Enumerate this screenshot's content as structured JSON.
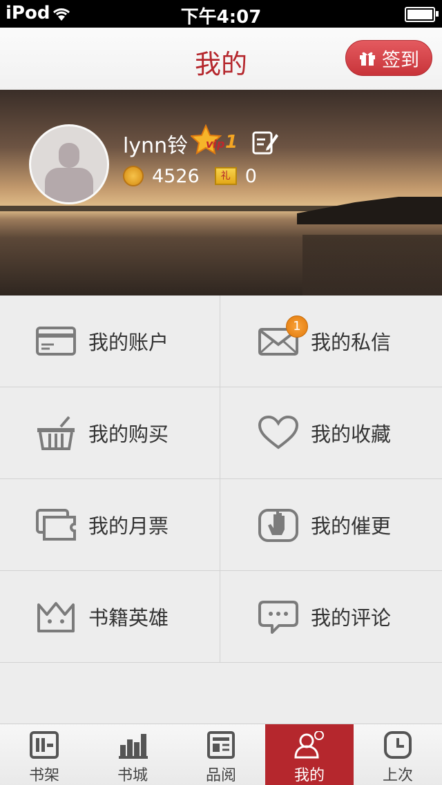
{
  "status_bar": {
    "carrier": "iPod",
    "time": "下午4:07"
  },
  "nav": {
    "title": "我的",
    "checkin_label": "签到"
  },
  "profile": {
    "username": "lynn铃",
    "vip_label": "vip",
    "vip_level": "1",
    "coins": "4526",
    "gifts": "0",
    "gift_icon_text": "礼"
  },
  "menu": [
    {
      "label": "我的账户",
      "icon": "wallet-card-icon"
    },
    {
      "label": "我的私信",
      "icon": "envelope-icon",
      "badge": "1"
    },
    {
      "label": "我的购买",
      "icon": "basket-icon"
    },
    {
      "label": "我的收藏",
      "icon": "heart-icon"
    },
    {
      "label": "我的月票",
      "icon": "tickets-icon"
    },
    {
      "label": "我的催更",
      "icon": "hand-icon"
    },
    {
      "label": "书籍英雄",
      "icon": "crown-icon"
    },
    {
      "label": "我的评论",
      "icon": "chat-bubble-icon"
    }
  ],
  "tabs": [
    {
      "label": "书架",
      "icon": "bookshelf-icon"
    },
    {
      "label": "书城",
      "icon": "bar-chart-icon"
    },
    {
      "label": "品阅",
      "icon": "newspaper-icon"
    },
    {
      "label": "我的",
      "icon": "user-icon",
      "active": true
    },
    {
      "label": "上次",
      "icon": "clock-icon"
    }
  ],
  "colors": {
    "accent": "#b5272d",
    "background": "#ededed",
    "icon_gray": "#7b7b7b"
  }
}
